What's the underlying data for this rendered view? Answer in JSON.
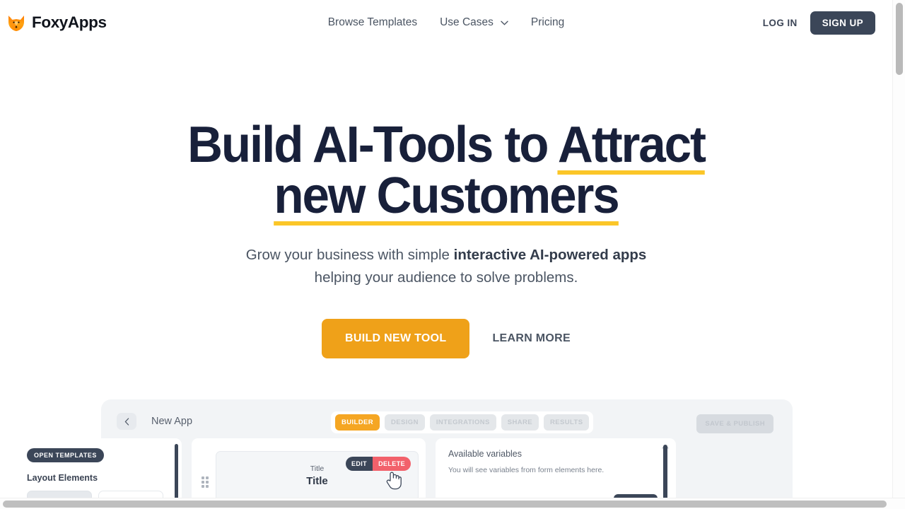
{
  "brand": {
    "name": "FoxyApps",
    "logo_icon": "fox-face-icon"
  },
  "nav": {
    "browse_templates": "Browse Templates",
    "use_cases": "Use Cases",
    "pricing": "Pricing",
    "dropdown_icon": "chevron-down-icon",
    "log_in": "LOG IN",
    "sign_up": "SIGN UP"
  },
  "hero": {
    "headline_part1": "Build AI-Tools to ",
    "headline_highlight1": "Attract",
    "headline_highlight2": "new Customers",
    "subhead_pre": "Grow your business with simple ",
    "subhead_bold": "interactive AI-powered apps",
    "subhead_post": " helping your audience to solve problems.",
    "cta_primary": "BUILD NEW TOOL",
    "cta_secondary": "LEARN MORE"
  },
  "preview": {
    "back_icon": "chevron-left-icon",
    "app_title": "New App",
    "tabs": [
      {
        "label": "BUILDER",
        "active": true
      },
      {
        "label": "DESIGN",
        "active": false
      },
      {
        "label": "INTEGRATIONS",
        "active": false
      },
      {
        "label": "SHARE",
        "active": false
      },
      {
        "label": "RESULTS",
        "active": false
      }
    ],
    "save_publish": "SAVE & PUBLISH",
    "left_panel": {
      "open_templates": "OPEN TEMPLATES",
      "layout_elements": "Layout Elements"
    },
    "center_panel": {
      "drag_handle_icon": "drag-dots-icon",
      "card_label": "Title",
      "card_title": "Title",
      "edit": "EDIT",
      "delete": "DELETE",
      "cursor_icon": "pointing-hand-cursor-icon"
    },
    "right_panel": {
      "heading": "Available variables",
      "description": "You will see variables from form elements here."
    }
  },
  "colors": {
    "accent_orange": "#efa119",
    "highlight_yellow": "#fbc628",
    "dark_navy": "#3b4658",
    "headline": "#18203a",
    "danger_red": "#f2616b"
  }
}
